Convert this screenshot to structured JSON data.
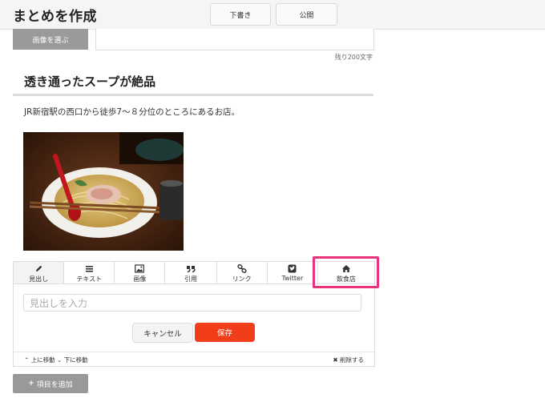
{
  "header": {
    "title": "まとめを作成",
    "draft_label": "下書き",
    "publish_label": "公開"
  },
  "image_select": {
    "button_label": "画像を選ぶ",
    "remaining": "残り200文字"
  },
  "item": {
    "heading": "透き通ったスープが絶品",
    "text": "JR新宿駅の西口から徒歩7〜８分位のところにあるお店。"
  },
  "editor": {
    "tabs": [
      {
        "label": "見出し",
        "icon": "pencil-icon"
      },
      {
        "label": "テキスト",
        "icon": "list-icon"
      },
      {
        "label": "画像",
        "icon": "image-icon"
      },
      {
        "label": "引用",
        "icon": "quote-icon"
      },
      {
        "label": "リンク",
        "icon": "link-icon"
      },
      {
        "label": "Twitter",
        "icon": "twitter-icon"
      },
      {
        "label": "飲食店",
        "icon": "home-icon"
      }
    ],
    "input_placeholder": "見出しを入力",
    "cancel_label": "キャンセル",
    "save_label": "保存",
    "move_up": "上に移動",
    "move_down": "下に移動",
    "delete_label": "削除する"
  },
  "add_item_label": "項目を追加",
  "colors": {
    "save": "#f23d1b",
    "highlight": "#e8327e",
    "gray_button": "#999999"
  }
}
